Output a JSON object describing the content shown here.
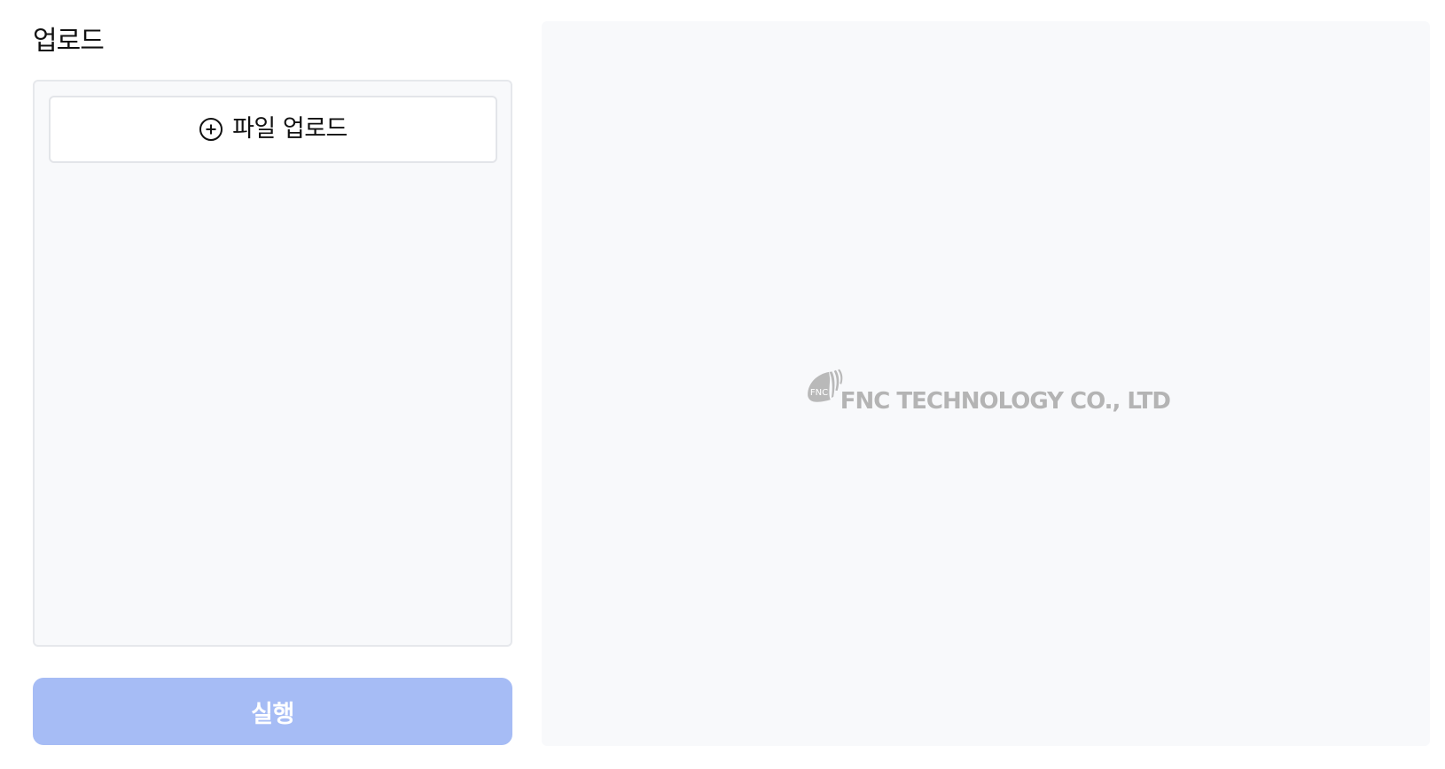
{
  "upload_section": {
    "title": "업로드",
    "upload_button_label": "파일 업로드",
    "upload_icon": "plus-circle-icon"
  },
  "run_button": {
    "label": "실행",
    "color": "#a6bcf5"
  },
  "preview": {
    "logo": {
      "mark_text": "FNC",
      "company_name": "FNC TECHNOLOGY CO., LTD",
      "color": "#b4b4b4"
    }
  }
}
